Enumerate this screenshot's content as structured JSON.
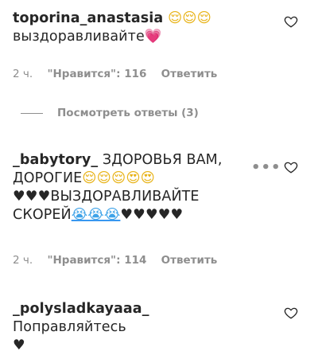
{
  "comments": [
    {
      "username": "toporina_anastasia",
      "emoji_a": "😌😌😌",
      "text": "выздоравливайте",
      "emoji_b": "💗",
      "time": "2 ч.",
      "likes": "\"Нравится\": 116",
      "reply_label": "Ответить"
    },
    {
      "username": "_babytory_",
      "text_a": "ЗДОРОВЬЯ ВАМ,",
      "text_b": "ДОРОГИЕ",
      "emoji_a": "😌😌😌",
      "emoji_b": "😍😍",
      "emoji_c": "♥♥♥",
      "text_c": "ВЫЗДОРАВЛИВАЙТЕ",
      "text_d": "СКОРЕЙ",
      "emoji_d": "😭😭😭",
      "emoji_e": "♥♥♥♥♥",
      "time": "2 ч.",
      "likes": "\"Нравится\": 114",
      "reply_label": "Ответить"
    },
    {
      "username": "_polysladkayaaa_",
      "text": "Поправляйтесь",
      "emoji": "♥"
    }
  ],
  "view_replies_label": "Посмотреть ответы (3)",
  "more_icon": "•••",
  "colors": {
    "text": "#262626",
    "meta": "#8e8e8e",
    "pink_heart": "#ed4a72",
    "link_blue": "#3897f0"
  }
}
